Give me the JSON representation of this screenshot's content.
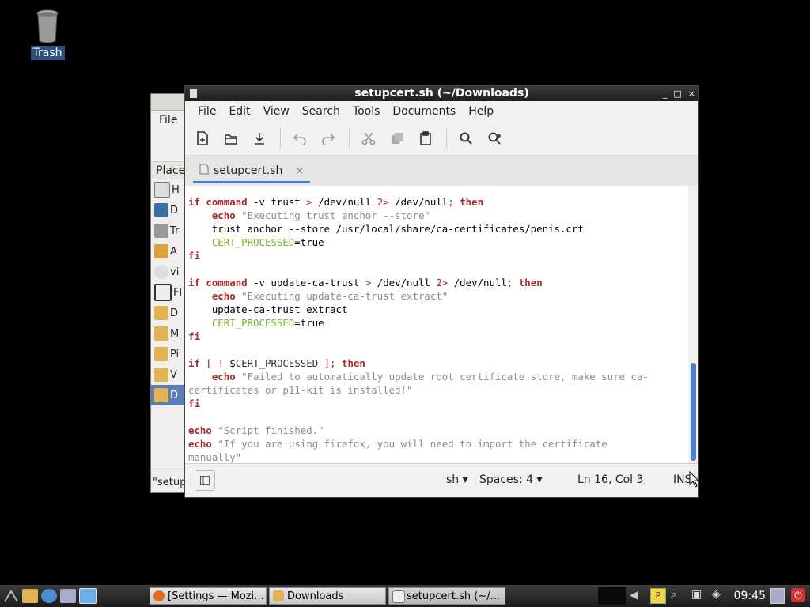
{
  "desktop": {
    "trash_label": "Trash"
  },
  "file_manager": {
    "menu_label": "File",
    "places_label": "Place",
    "items": [
      "H",
      "D",
      "Tr",
      "A",
      "vi",
      "Fl",
      "D",
      "M",
      "Pi",
      "V",
      "D"
    ],
    "status": "\"setup"
  },
  "editor": {
    "title": "setupcert.sh (~/Downloads)",
    "window_controls": [
      "_",
      "□",
      "×"
    ],
    "menu": [
      "File",
      "Edit",
      "View",
      "Search",
      "Tools",
      "Documents",
      "Help"
    ],
    "tab": {
      "label": "setupcert.sh",
      "close": "×"
    },
    "code_lines": [
      "if command -v trust > /dev/null 2> /dev/null; then",
      "    echo \"Executing trust anchor --store\"",
      "    trust anchor --store /usr/local/share/ca-certificates/penis.crt",
      "    CERT_PROCESSED=true",
      "fi",
      "",
      "if command -v update-ca-trust > /dev/null 2> /dev/null; then",
      "    echo \"Executing update-ca-trust extract\"",
      "    update-ca-trust extract",
      "    CERT_PROCESSED=true",
      "fi",
      "",
      "if [ ! $CERT_PROCESSED ]; then",
      "    echo \"Failed to automatically update root certificate store, make sure ca-",
      "certificates or p11-kit is installed!\"",
      "fi",
      "",
      "echo \"Script finished.\"",
      "echo \"If you are using firefox, you will need to import the certificate",
      "manually\""
    ],
    "status": {
      "language": "sh",
      "spaces": "Spaces: 4",
      "position": "Ln 16, Col 3",
      "mode": "INS"
    }
  },
  "taskbar": {
    "tasks": [
      "[Settings — Mozi...",
      "Downloads",
      "setupcert.sh (~/..."
    ],
    "clock": "09:45"
  }
}
